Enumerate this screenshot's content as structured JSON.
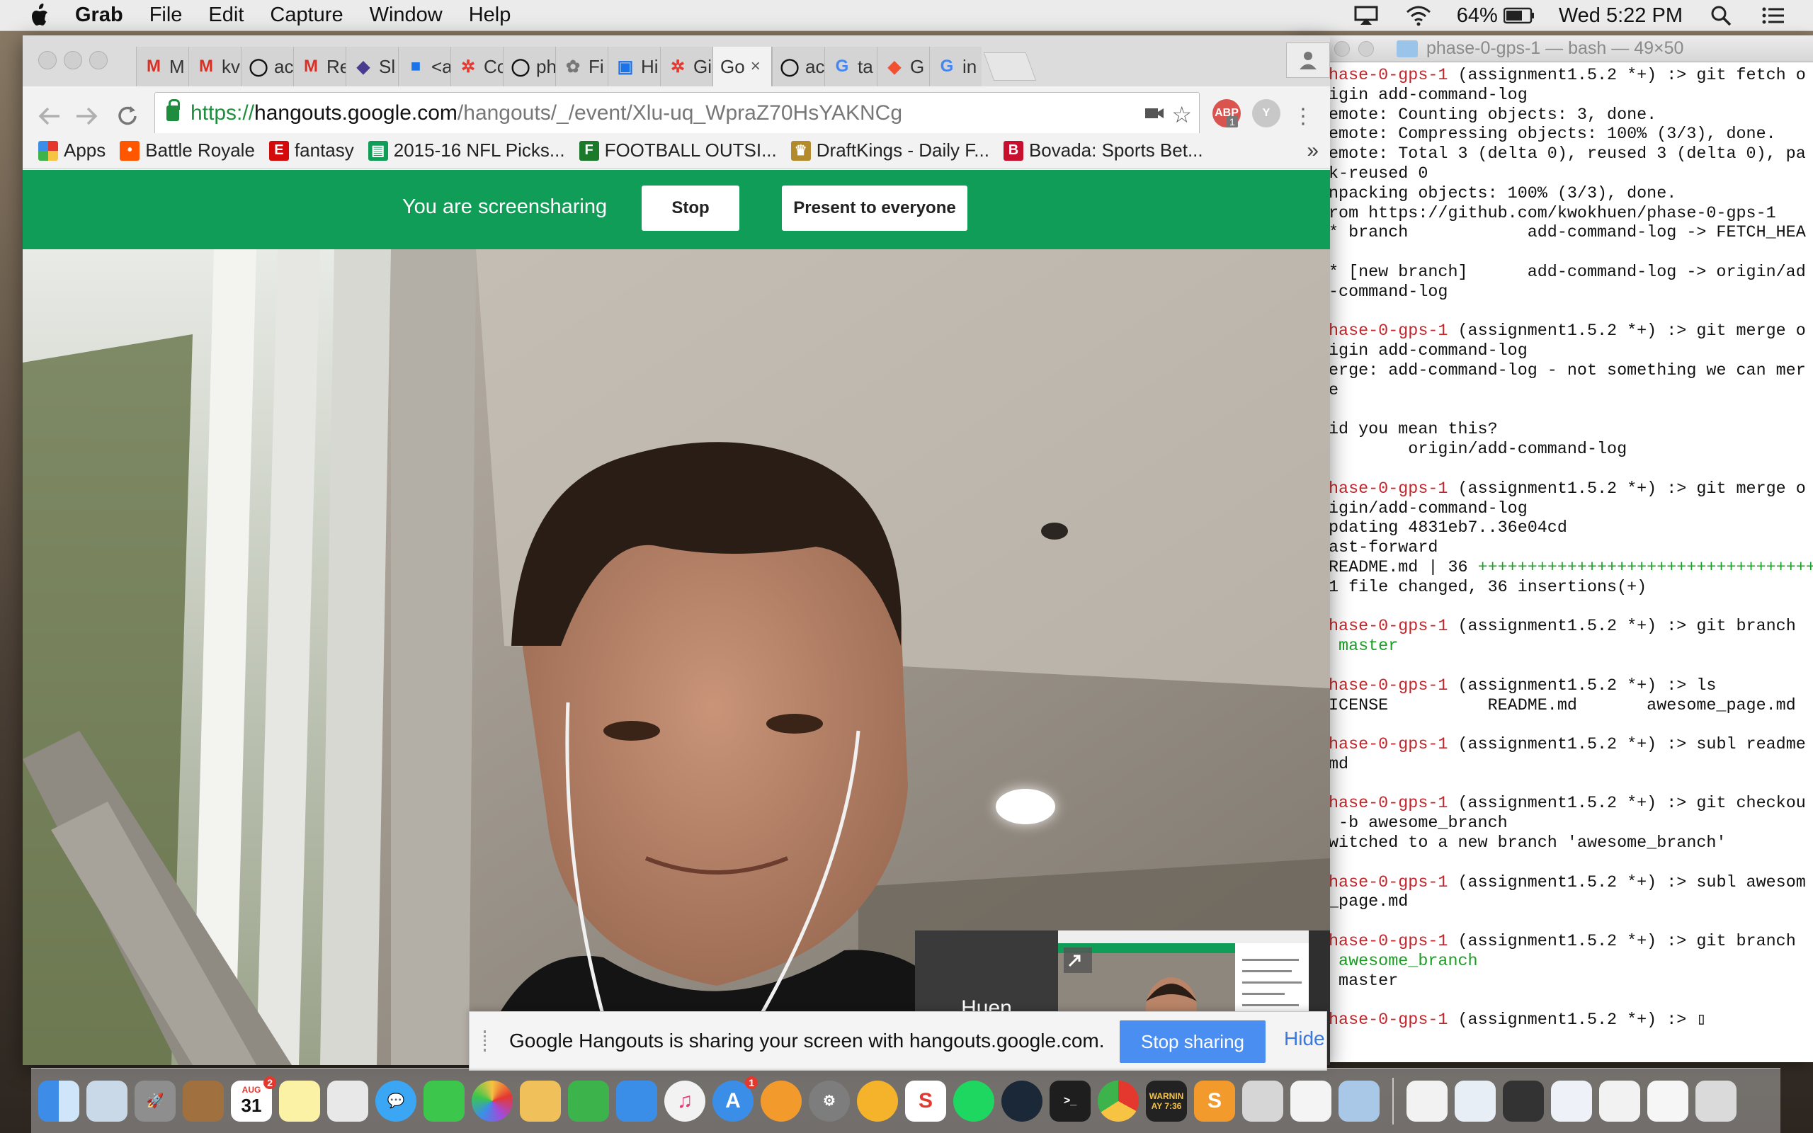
{
  "menubar": {
    "app": "Grab",
    "items": [
      "File",
      "Edit",
      "Capture",
      "Window",
      "Help"
    ],
    "battery": "64%",
    "clock": "Wed 5:22 PM"
  },
  "terminal": {
    "title": "phase-0-gps-1 — bash — 49×50",
    "lines": [
      {
        "p": "hase-0-gps-1",
        "t": " (assignment1.5.2 *+) :> git fetch o"
      },
      {
        "t": "igin add-command-log"
      },
      {
        "t": "emote: Counting objects: 3, done."
      },
      {
        "t": "emote: Compressing objects: 100% (3/3), done."
      },
      {
        "t": "emote: Total 3 (delta 0), reused 3 (delta 0), pa"
      },
      {
        "t": "k-reused 0"
      },
      {
        "t": "npacking objects: 100% (3/3), done."
      },
      {
        "t": "rom https://github.com/kwokhuen/phase-0-gps-1"
      },
      {
        "t": "* branch            add-command-log -> FETCH_HEA"
      },
      {
        "t": ""
      },
      {
        "t": "* [new branch]      add-command-log -> origin/ad"
      },
      {
        "t": "-command-log"
      },
      {
        "t": ""
      },
      {
        "p": "hase-0-gps-1",
        "t": " (assignment1.5.2 *+) :> git merge o"
      },
      {
        "t": "igin add-command-log"
      },
      {
        "t": "erge: add-command-log - not something we can mer"
      },
      {
        "t": "e"
      },
      {
        "t": ""
      },
      {
        "t": "id you mean this?"
      },
      {
        "t": "        origin/add-command-log"
      },
      {
        "t": ""
      },
      {
        "p": "hase-0-gps-1",
        "t": " (assignment1.5.2 *+) :> git merge o"
      },
      {
        "t": "igin/add-command-log"
      },
      {
        "t": "pdating 4831eb7..36e04cd"
      },
      {
        "t": "ast-forward"
      },
      {
        "t": "README.md | 36 ",
        "g": "++++++++++++++++++++++++++++++++++++"
      },
      {
        "t": "1 file changed, 36 insertions(+)"
      },
      {
        "t": ""
      },
      {
        "p": "hase-0-gps-1",
        "t": " (assignment1.5.2 *+) :> git branch"
      },
      {
        "g": " master"
      },
      {
        "t": ""
      },
      {
        "p": "hase-0-gps-1",
        "t": " (assignment1.5.2 *+) :> ls"
      },
      {
        "t": "ICENSE          README.md       awesome_page.md"
      },
      {
        "t": ""
      },
      {
        "p": "hase-0-gps-1",
        "t": " (assignment1.5.2 *+) :> subl readme"
      },
      {
        "t": "md"
      },
      {
        "t": ""
      },
      {
        "p": "hase-0-gps-1",
        "t": " (assignment1.5.2 *+) :> git checkou"
      },
      {
        "t": " -b awesome_branch"
      },
      {
        "t": "witched to a new branch 'awesome_branch'"
      },
      {
        "t": ""
      },
      {
        "p": "hase-0-gps-1",
        "t": " (assignment1.5.2 *+) :> subl awesom"
      },
      {
        "t": "_page.md"
      },
      {
        "t": ""
      },
      {
        "p": "hase-0-gps-1",
        "t": " (assignment1.5.2 *+) :> git branch"
      },
      {
        "g": " awesome_branch"
      },
      {
        "t": " master"
      },
      {
        "t": ""
      },
      {
        "p": "hase-0-gps-1",
        "t": " (assignment1.5.2 *+) :> ▯"
      }
    ]
  },
  "chrome": {
    "tabs": [
      {
        "icon": "gmail-icon",
        "label": "M"
      },
      {
        "icon": "gmail-icon",
        "label": "kv"
      },
      {
        "icon": "github-icon",
        "label": "ac"
      },
      {
        "icon": "gmail-icon",
        "label": "Re"
      },
      {
        "icon": "app-icon",
        "label": "Sl"
      },
      {
        "icon": "map-icon",
        "label": "<a"
      },
      {
        "icon": "gear-icon",
        "label": "Co"
      },
      {
        "icon": "github-icon",
        "label": "ph"
      },
      {
        "icon": "leaf-icon",
        "label": "Fi"
      },
      {
        "icon": "tile-icon",
        "label": "Hi"
      },
      {
        "icon": "gear-icon",
        "label": "Gi"
      },
      {
        "icon": "none",
        "label": "Go",
        "active": true,
        "close": "×"
      },
      {
        "icon": "github-icon",
        "label": "ac"
      },
      {
        "icon": "google-icon",
        "label": "ta"
      },
      {
        "icon": "git-icon",
        "label": "G"
      },
      {
        "icon": "google-icon",
        "label": "in"
      }
    ],
    "url": {
      "scheme": "https://",
      "host": "hangouts.google.com",
      "path": "/hangouts/_/event/Xlu-uq_WpraZ70HsYAKNCg"
    },
    "bookmarks": [
      {
        "icon": "apps-icon",
        "label": "Apps"
      },
      {
        "icon": "reddit-icon",
        "label": "Battle Royale"
      },
      {
        "icon": "espn-icon",
        "label": "fantasy"
      },
      {
        "icon": "sheets-icon",
        "label": "2015-16 NFL Picks..."
      },
      {
        "icon": "football-icon",
        "label": "FOOTBALL OUTSI..."
      },
      {
        "icon": "draftkings-icon",
        "label": "DraftKings - Daily F..."
      },
      {
        "icon": "bovada-icon",
        "label": "Bovada: Sports Bet..."
      }
    ],
    "bookmarks_more": "»",
    "ext_badge": "1"
  },
  "hangout": {
    "banner_msg": "You are screensharing",
    "stop_label": "Stop",
    "present_label": "Present to everyone",
    "participant_name": "Huen",
    "share_notice": "Google Hangouts is sharing your screen with hangouts.google.com.",
    "stop_sharing_label": "Stop sharing",
    "hide_label": "Hide"
  },
  "dock": {
    "calendar_month": "AUG",
    "calendar_day": "31",
    "calendar_badge": "2",
    "appstore_badge": "1",
    "console_text": "WARNIN",
    "console_time": "AY 7:36"
  },
  "colors": {
    "hangouts_green": "#0f9d58",
    "prompt_red": "#c2262b",
    "git_green": "#1c9e26",
    "stop_sharing_blue": "#4a8ef2"
  }
}
